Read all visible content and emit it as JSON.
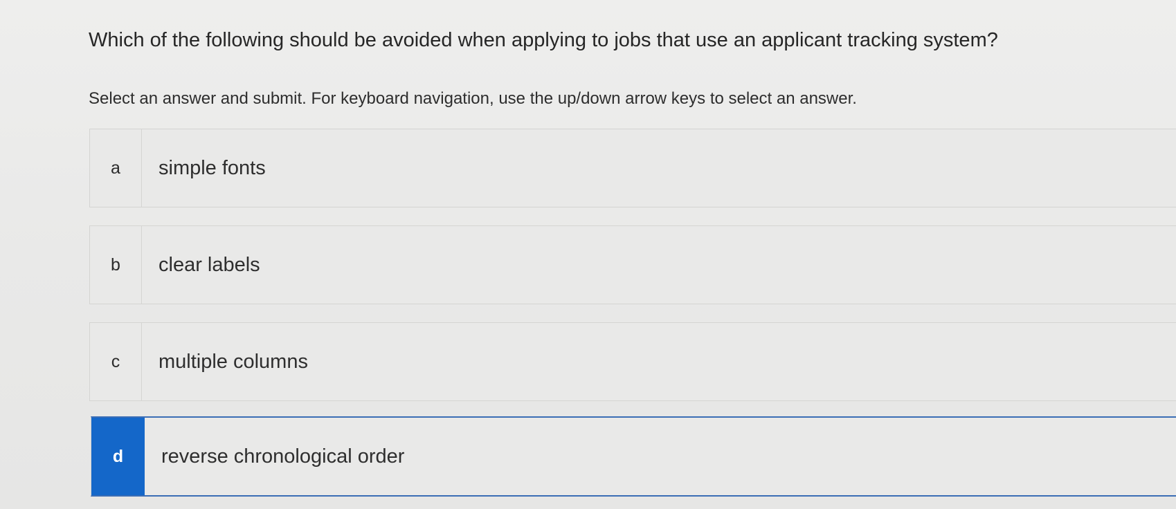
{
  "question": {
    "text": "Which of the following should be avoided when applying to jobs that use an applicant tracking system?"
  },
  "instructions": {
    "text": "Select an answer and submit. For keyboard navigation, use the up/down arrow keys to select an answer."
  },
  "options": [
    {
      "letter": "a",
      "text": "simple fonts",
      "selected": false
    },
    {
      "letter": "b",
      "text": "clear labels",
      "selected": false
    },
    {
      "letter": "c",
      "text": "multiple columns",
      "selected": false
    },
    {
      "letter": "d",
      "text": "reverse chronological order",
      "selected": true
    }
  ],
  "colors": {
    "selected_accent": "#1467c9",
    "background": "#ebebea"
  }
}
